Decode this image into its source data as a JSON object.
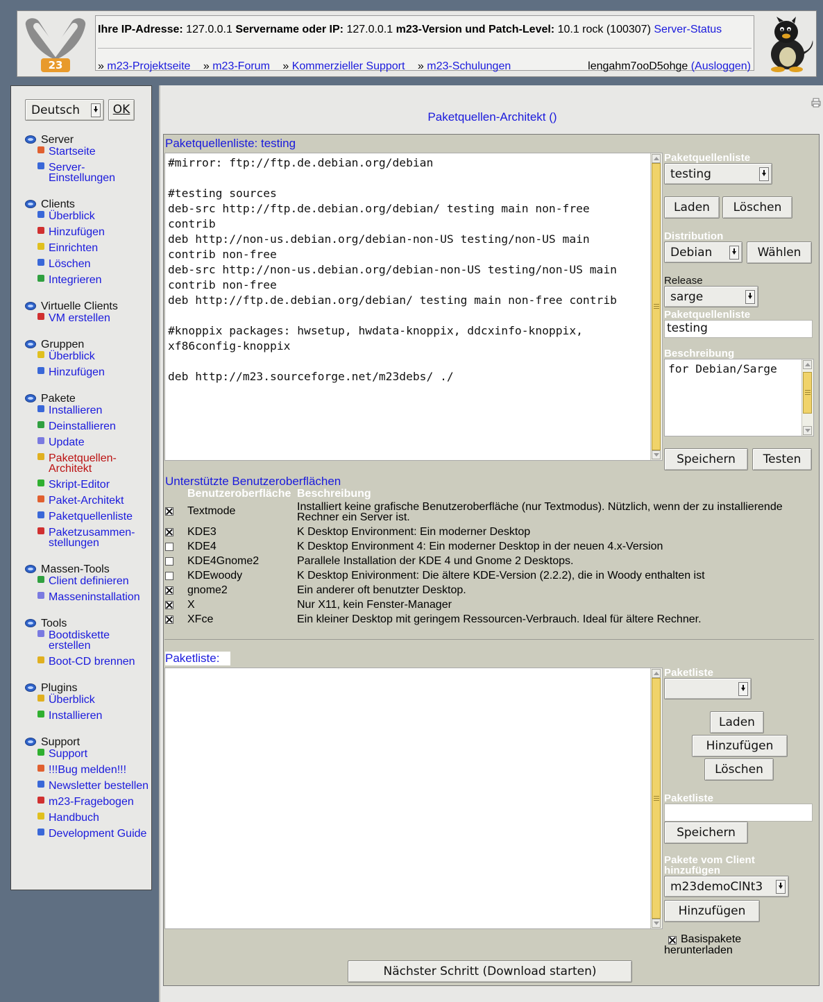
{
  "header": {
    "ip_label": "Ihre IP-Adresse:",
    "ip_value": "127.0.0.1",
    "server_label": "Servername oder IP:",
    "server_value": "127.0.0.1",
    "version_label": "m23-Version und Patch-Level:",
    "version_value": "10.1 rock (100307)",
    "server_status_link": "Server-Status",
    "nav": [
      {
        "prefix": "»",
        "label": "m23-Projektseite"
      },
      {
        "prefix": "»",
        "label": "m23-Forum"
      },
      {
        "prefix": "»",
        "label": "Kommerzieller Support"
      },
      {
        "prefix": "»",
        "label": "m23-Schulungen"
      }
    ],
    "username": "lengahm7ooD5ohge",
    "logout_label": "(Ausloggen)",
    "logo_text": "23"
  },
  "sidebar": {
    "language": "Deutsch",
    "ok_label": "OK",
    "sections": [
      {
        "title": "Server",
        "items": [
          "Startseite",
          "Server-Einstellungen"
        ]
      },
      {
        "title": "Clients",
        "items": [
          "Überblick",
          "Hinzufügen",
          "Einrichten",
          "Löschen",
          "Integrieren"
        ]
      },
      {
        "title": "Virtuelle Clients",
        "items": [
          "VM erstellen"
        ]
      },
      {
        "title": "Gruppen",
        "items": [
          "Überblick",
          "Hinzufügen"
        ]
      },
      {
        "title": "Pakete",
        "items": [
          "Installieren",
          "Deinstallieren",
          "Update",
          "Paketquellen-Architekt",
          "Skript-Editor",
          "Paket-Architekt",
          "Paketquellenliste",
          "Paketzusammen-stellungen"
        ]
      },
      {
        "title": "Massen-Tools",
        "items": [
          "Client definieren",
          "Masseninstallation"
        ]
      },
      {
        "title": "Tools",
        "items": [
          "Bootdiskette erstellen",
          "Boot-CD brennen"
        ]
      },
      {
        "title": "Plugins",
        "items": [
          "Überblick",
          "Installieren"
        ]
      },
      {
        "title": "Support",
        "items": [
          "Support",
          "!!!Bug melden!!!",
          "Newsletter bestellen",
          "m23-Fragebogen",
          "Handbuch",
          "Development Guide"
        ]
      }
    ]
  },
  "main": {
    "page_title": "Paketquellen-Architekt ()",
    "sources_title": "Paketquellenliste: testing",
    "sources_text": "#mirror: ftp://ftp.de.debian.org/debian\n\n#testing sources\ndeb-src http://ftp.de.debian.org/debian/ testing main non-free\ncontrib\ndeb http://non-us.debian.org/debian-non-US testing/non-US main\ncontrib non-free\ndeb-src http://non-us.debian.org/debian-non-US testing/non-US main\ncontrib non-free\ndeb http://ftp.de.debian.org/debian/ testing main non-free contrib\n\n#knoppix packages: hwsetup, hwdata-knoppix, ddcxinfo-knoppix,\nxf86config-knoppix\n\ndeb http://m23.sourceforge.net/m23debs/ ./",
    "right": {
      "sourcelist_label": "Paketquellenliste",
      "sourcelist_selected": "testing",
      "load_label": "Laden",
      "delete_label": "Löschen",
      "distribution_label": "Distribution",
      "distribution_selected": "Debian",
      "choose_label": "Wählen",
      "release_label": "Release",
      "release_selected": "sarge",
      "sourcelist_name_label": "Paketquellenliste",
      "sourcelist_name_value": "testing",
      "description_label": "Beschreibung",
      "description_value": "for Debian/Sarge",
      "save_label": "Speichern",
      "test_label": "Testen"
    },
    "gui_title": "Unterstützte Benutzeroberflächen",
    "gui_headers": [
      "Benutzeroberfläche",
      "Beschreibung"
    ],
    "gui_rows": [
      {
        "checked": true,
        "name": "Textmode",
        "desc": "Installiert keine grafische Benutzeroberfläche (nur Textmodus). Nützlich, wenn der zu installierende Rechner ein Server ist."
      },
      {
        "checked": true,
        "name": "KDE3",
        "desc": "K Desktop Environment: Ein moderner Desktop"
      },
      {
        "checked": false,
        "name": "KDE4",
        "desc": "K Desktop Environment 4: Ein moderner Desktop in der neuen 4.x-Version"
      },
      {
        "checked": false,
        "name": "KDE4Gnome2",
        "desc": "Parallele Installation der KDE 4 und Gnome 2 Desktops."
      },
      {
        "checked": false,
        "name": "KDEwoody",
        "desc": "K Desktop Enivironment: Die ältere KDE-Version (2.2.2), die in Woody enthalten ist"
      },
      {
        "checked": true,
        "name": "gnome2",
        "desc": "Ein anderer oft benutzter Desktop."
      },
      {
        "checked": true,
        "name": "X",
        "desc": "Nur X11, kein Fenster-Manager"
      },
      {
        "checked": true,
        "name": "XFce",
        "desc": "Ein kleiner Desktop mit geringem Ressourcen-Verbrauch. Ideal für ältere Rechner."
      }
    ],
    "packagelist_title": "Paketliste:",
    "packages": {
      "list_label": "Paketliste",
      "list_selected": "",
      "load_label": "Laden",
      "add_label": "Hinzufügen",
      "delete_label": "Löschen",
      "name_label": "Paketliste",
      "name_value": "",
      "save_label": "Speichern",
      "from_client_label": "Pakete vom Client hinzufügen",
      "client_selected": "m23demoClNt3",
      "client_add_label": "Hinzufügen",
      "base_label": "Basispakete herunterladen",
      "base_checked": true
    },
    "next_label": "Nächster Schritt (Download starten)"
  },
  "colors": {
    "link": "#1a1adc",
    "current": "#bb1111",
    "panel": "#ccccbe",
    "background": "#5f6f82"
  },
  "icons": [
    "logo-icon",
    "mascot-icon",
    "print-icon",
    "section-arrow-icon"
  ]
}
